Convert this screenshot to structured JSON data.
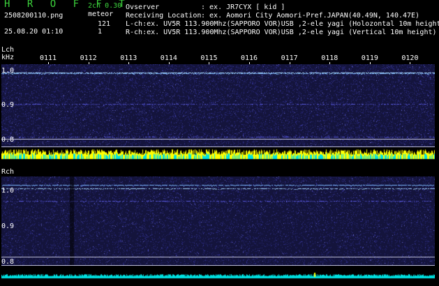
{
  "header": {
    "app_title": "H R O F F T",
    "mode": "2ch 0.30",
    "filename": "2508200110.png",
    "meteor_label": "meteor",
    "meteor_l_count": "121",
    "meteor_r_count": "1",
    "datetime": "25.08.20 01:10",
    "observer_label": "Ovserver",
    "observer_value": ": ex. JR7CYX [ kid ]",
    "location_label": "Receiving Location",
    "location_value": ": ex. Aomori City Aomori-Pref.JAPAN(40.49N, 140.47E)",
    "lch_info": "L-ch:ex. UV5R 113.900Mhz(SAPPORO VOR)USB ,2-ele yagi (Holozontal 10m height)",
    "rch_info": "R-ch:ex. UV5R 113.900Mhz(SAPPORO VOR)USB ,2-ele yagi (Vertical 10m height)"
  },
  "axis": {
    "lch_label": "Lch",
    "unit_label": "kHz",
    "rch_label": "Rch",
    "minute_ticks": [
      "0111",
      "0112",
      "0113",
      "0114",
      "0115",
      "0116",
      "0117",
      "0118",
      "0119",
      "0120"
    ],
    "lch_y_labels": [
      "1.0",
      "0.9",
      "0.8"
    ],
    "rch_y_labels": [
      "1.0",
      "0.9",
      "0.8"
    ]
  },
  "colors": {
    "title_green": "#3cd23c",
    "waterfall_bg": "#14143c",
    "signal_line": "#a8d8ff",
    "level_yellow": "#ffff00",
    "level_cyan": "#00e0e0"
  }
}
